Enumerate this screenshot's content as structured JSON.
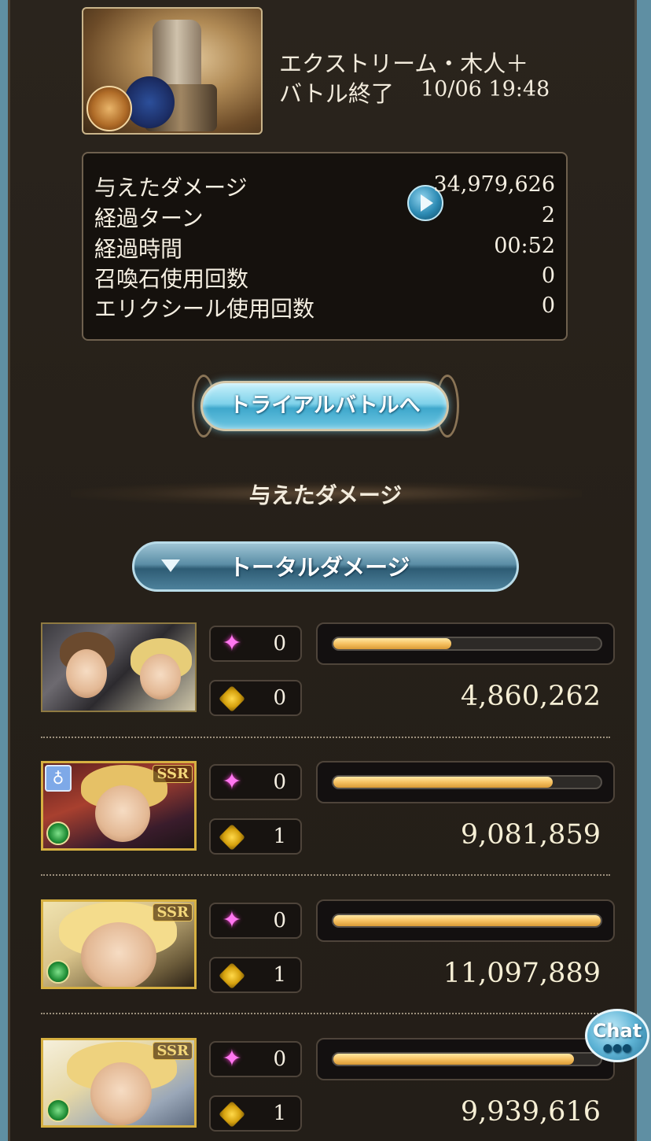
{
  "quest": {
    "title": "エクストリーム・木人＋",
    "status": "バトル終了",
    "datetime": "10/06 19:48"
  },
  "stats": [
    {
      "label": "与えたダメージ",
      "value": "34,979,626"
    },
    {
      "label": "経過ターン",
      "value": "2"
    },
    {
      "label": "経過時間",
      "value": "00:52"
    },
    {
      "label": "召喚石使用回数",
      "value": "0"
    },
    {
      "label": "エリクシール使用回数",
      "value": "0"
    }
  ],
  "trial_button": "トライアルバトルへ",
  "section_title": "与えたダメージ",
  "damage_filter": "トータルダメージ",
  "ssr_badge": "SSR",
  "characters": [
    {
      "skill_count": "0",
      "ougi_count": "0",
      "damage": "4,860,262",
      "bar_fraction": 0.44
    },
    {
      "skill_count": "0",
      "ougi_count": "1",
      "damage": "9,081,859",
      "bar_fraction": 0.82
    },
    {
      "skill_count": "0",
      "ougi_count": "1",
      "damage": "11,097,889",
      "bar_fraction": 1.0
    },
    {
      "skill_count": "0",
      "ougi_count": "1",
      "damage": "9,939,616",
      "bar_fraction": 0.9
    }
  ],
  "chat_label": "Chat",
  "colors": {
    "bar": "#f7c262",
    "accent_blue": "#3fa8cc",
    "panel": "#15110d"
  }
}
